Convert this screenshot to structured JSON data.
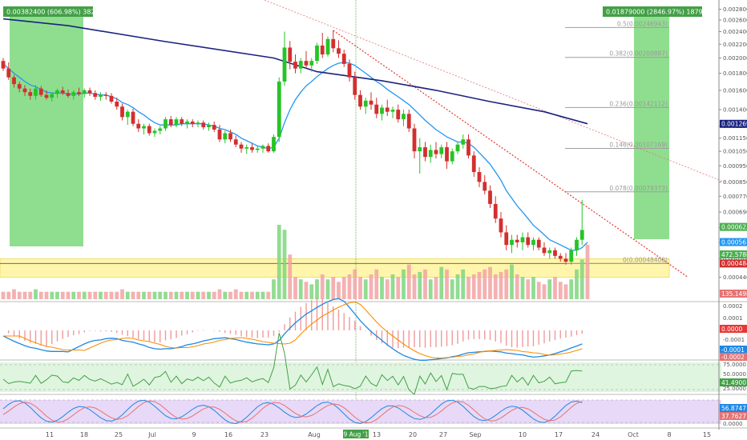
{
  "chart_data": {
    "type": "candlestick",
    "grid": false,
    "price_axis": {
      "ticks": [
        "0.00280000",
        "0.00260000",
        "0.00240000",
        "0.00220000",
        "0.00200000",
        "0.00180000",
        "0.00160000",
        "0.00140000",
        "0.00125000",
        "0.00115000",
        "0.00105000",
        "0.00095000",
        "0.00085000",
        "0.00077000",
        "0.00069000",
        "0.00062000",
        "0.00056000",
        "0.00050000",
        "0.00044000"
      ],
      "tick_values": [
        0.0028,
        0.0026,
        0.0024,
        0.0022,
        0.002,
        0.0018,
        0.0016,
        0.0014,
        0.00125,
        0.00115,
        0.00105,
        0.00095,
        0.00085,
        0.00077,
        0.00069,
        0.00062,
        0.00056,
        0.0005,
        0.00044
      ],
      "scale": "log"
    },
    "time_axis": {
      "labels": [
        "11",
        "18",
        "25",
        "Jul",
        "9",
        "16",
        "23",
        "Aug",
        "13",
        "20",
        "27",
        "Sep",
        "10",
        "17",
        "24",
        "Oct",
        "8",
        "15"
      ],
      "highlight": "09 Aug '18"
    },
    "candles": [
      [
        0.00196,
        0.002,
        0.00183,
        0.00186
      ],
      [
        0.00186,
        0.00194,
        0.00172,
        0.00175
      ],
      [
        0.00175,
        0.00178,
        0.00163,
        0.00167
      ],
      [
        0.00167,
        0.0017,
        0.00158,
        0.00162
      ],
      [
        0.00162,
        0.00166,
        0.00154,
        0.00158
      ],
      [
        0.00158,
        0.00162,
        0.0015,
        0.00154
      ],
      [
        0.00154,
        0.00166,
        0.0015,
        0.00162
      ],
      [
        0.00162,
        0.00165,
        0.00153,
        0.00155
      ],
      [
        0.00155,
        0.0016,
        0.0015,
        0.00152
      ],
      [
        0.00152,
        0.00158,
        0.00148,
        0.00156
      ],
      [
        0.00156,
        0.00162,
        0.00152,
        0.0016
      ],
      [
        0.0016,
        0.00164,
        0.00155,
        0.00157
      ],
      [
        0.00157,
        0.00161,
        0.00152,
        0.00154
      ],
      [
        0.00154,
        0.0016,
        0.0015,
        0.00158
      ],
      [
        0.00158,
        0.00163,
        0.00154,
        0.00156
      ],
      [
        0.00156,
        0.00162,
        0.00152,
        0.0016
      ],
      [
        0.0016,
        0.00163,
        0.00154,
        0.00157
      ],
      [
        0.00157,
        0.0016,
        0.0015,
        0.00153
      ],
      [
        0.00153,
        0.00158,
        0.00149,
        0.00155
      ],
      [
        0.00155,
        0.00158,
        0.0015,
        0.00154
      ],
      [
        0.00154,
        0.00157,
        0.00146,
        0.00148
      ],
      [
        0.00148,
        0.00152,
        0.0014,
        0.00143
      ],
      [
        0.00143,
        0.00146,
        0.0013,
        0.00133
      ],
      [
        0.00133,
        0.0014,
        0.00126,
        0.00138
      ],
      [
        0.00138,
        0.00141,
        0.00125,
        0.00127
      ],
      [
        0.00127,
        0.00131,
        0.0012,
        0.00123
      ],
      [
        0.00123,
        0.00127,
        0.00118,
        0.00125
      ],
      [
        0.00125,
        0.00127,
        0.00117,
        0.00119
      ],
      [
        0.00119,
        0.00123,
        0.00116,
        0.00121
      ],
      [
        0.00121,
        0.00125,
        0.00118,
        0.00123
      ],
      [
        0.00123,
        0.00133,
        0.00121,
        0.00131
      ],
      [
        0.00131,
        0.00134,
        0.00124,
        0.00126
      ],
      [
        0.00126,
        0.00133,
        0.00124,
        0.00131
      ],
      [
        0.00131,
        0.00133,
        0.00125,
        0.00127
      ],
      [
        0.00127,
        0.00131,
        0.00123,
        0.00129
      ],
      [
        0.00129,
        0.00131,
        0.00124,
        0.00127
      ],
      [
        0.00127,
        0.0013,
        0.00124,
        0.00128
      ],
      [
        0.00128,
        0.0013,
        0.00122,
        0.00124
      ],
      [
        0.00124,
        0.00128,
        0.00121,
        0.00126
      ],
      [
        0.00126,
        0.00129,
        0.0012,
        0.00122
      ],
      [
        0.00122,
        0.00126,
        0.00112,
        0.00114
      ],
      [
        0.00114,
        0.00121,
        0.00111,
        0.00119
      ],
      [
        0.00119,
        0.00122,
        0.00112,
        0.00114
      ],
      [
        0.00114,
        0.00117,
        0.00108,
        0.0011
      ],
      [
        0.0011,
        0.00112,
        0.00104,
        0.00107
      ],
      [
        0.00107,
        0.0011,
        0.00103,
        0.00108
      ],
      [
        0.00108,
        0.00111,
        0.00104,
        0.00106
      ],
      [
        0.00106,
        0.00109,
        0.00104,
        0.00107
      ],
      [
        0.00107,
        0.0011,
        0.00104,
        0.00109
      ],
      [
        0.00109,
        0.00111,
        0.00104,
        0.00105
      ],
      [
        0.00105,
        0.00118,
        0.00104,
        0.00116
      ],
      [
        0.00116,
        0.00175,
        0.00112,
        0.0017
      ],
      [
        0.0017,
        0.0024,
        0.00165,
        0.00215
      ],
      [
        0.00215,
        0.00225,
        0.00185,
        0.00195
      ],
      [
        0.00195,
        0.00205,
        0.0018,
        0.00186
      ],
      [
        0.00186,
        0.002,
        0.0018,
        0.00196
      ],
      [
        0.00196,
        0.0021,
        0.00186,
        0.0019
      ],
      [
        0.0019,
        0.002,
        0.00182,
        0.00196
      ],
      [
        0.00196,
        0.00222,
        0.00192,
        0.00218
      ],
      [
        0.00218,
        0.00238,
        0.002,
        0.00205
      ],
      [
        0.00205,
        0.00232,
        0.00202,
        0.00228
      ],
      [
        0.00228,
        0.00242,
        0.00208,
        0.00214
      ],
      [
        0.00214,
        0.00226,
        0.002,
        0.00206
      ],
      [
        0.00206,
        0.00212,
        0.00188,
        0.00192
      ],
      [
        0.00192,
        0.00198,
        0.0017,
        0.00175
      ],
      [
        0.00175,
        0.00182,
        0.0015,
        0.00155
      ],
      [
        0.00155,
        0.0016,
        0.0014,
        0.00143
      ],
      [
        0.00143,
        0.00152,
        0.00136,
        0.00149
      ],
      [
        0.00149,
        0.00158,
        0.0014,
        0.00145
      ],
      [
        0.00145,
        0.00152,
        0.00132,
        0.00136
      ],
      [
        0.00136,
        0.00145,
        0.0013,
        0.00142
      ],
      [
        0.00142,
        0.0015,
        0.00134,
        0.00138
      ],
      [
        0.00138,
        0.00143,
        0.00132,
        0.0014
      ],
      [
        0.0014,
        0.00145,
        0.00128,
        0.00131
      ],
      [
        0.00131,
        0.0014,
        0.00125,
        0.00136
      ],
      [
        0.00136,
        0.0014,
        0.0012,
        0.00123
      ],
      [
        0.00123,
        0.00127,
        0.001,
        0.00105
      ],
      [
        0.00105,
        0.00115,
        0.0009,
        0.00108
      ],
      [
        0.00108,
        0.00112,
        0.00098,
        0.00101
      ],
      [
        0.00101,
        0.0011,
        0.00097,
        0.00106
      ],
      [
        0.00106,
        0.00112,
        0.001,
        0.00103
      ],
      [
        0.00103,
        0.0011,
        0.001,
        0.00108
      ],
      [
        0.00108,
        0.00112,
        0.00093,
        0.00098
      ],
      [
        0.00098,
        0.00107,
        0.00096,
        0.00105
      ],
      [
        0.00105,
        0.00112,
        0.00103,
        0.0011
      ],
      [
        0.0011,
        0.00118,
        0.00107,
        0.00114
      ],
      [
        0.00114,
        0.00118,
        0.001,
        0.00102
      ],
      [
        0.00102,
        0.00105,
        0.00088,
        0.00091
      ],
      [
        0.00091,
        0.00094,
        0.00082,
        0.00085
      ],
      [
        0.00085,
        0.00089,
        0.00078,
        0.0008
      ],
      [
        0.0008,
        0.00083,
        0.00071,
        0.00073
      ],
      [
        0.00073,
        0.00077,
        0.00064,
        0.00066
      ],
      [
        0.00066,
        0.00069,
        0.00058,
        0.0006
      ],
      [
        0.0006,
        0.00063,
        0.00053,
        0.00055
      ],
      [
        0.00055,
        0.00059,
        0.00052,
        0.00057
      ],
      [
        0.00057,
        0.00059,
        0.00054,
        0.00056
      ],
      [
        0.00056,
        0.0006,
        0.00053,
        0.00058
      ],
      [
        0.00058,
        0.0006,
        0.00054,
        0.00055
      ],
      [
        0.00055,
        0.00058,
        0.00053,
        0.00057
      ],
      [
        0.00057,
        0.00058,
        0.00053,
        0.00054
      ],
      [
        0.00054,
        0.00056,
        0.00051,
        0.00052
      ],
      [
        0.00052,
        0.00054,
        0.0005,
        0.00053
      ],
      [
        0.00053,
        0.00054,
        0.0005,
        0.00051
      ],
      [
        0.00051,
        0.00052,
        0.00049,
        0.0005
      ],
      [
        0.0005,
        0.00052,
        0.00048,
        0.00049
      ],
      [
        0.00049,
        0.00054,
        0.00048,
        0.00053
      ],
      [
        0.00053,
        0.00058,
        0.00051,
        0.00057
      ],
      [
        0.00057,
        0.00075,
        0.00055,
        0.00061
      ]
    ],
    "ma_fast": [
      0.00192,
      0.00186,
      0.0018,
      0.00175,
      0.0017,
      0.00166,
      0.00164,
      0.00161,
      0.00158,
      0.00157,
      0.00157,
      0.00157,
      0.00156,
      0.00156,
      0.00156,
      0.00157,
      0.00157,
      0.00156,
      0.00155,
      0.00155,
      0.00153,
      0.00151,
      0.00147,
      0.00145,
      0.00142,
      0.00138,
      0.00135,
      0.00131,
      0.00128,
      0.00126,
      0.00126,
      0.00126,
      0.00126,
      0.00127,
      0.00127,
      0.00127,
      0.00127,
      0.00127,
      0.00126,
      0.00125,
      0.00123,
      0.00122,
      0.0012,
      0.00118,
      0.00115,
      0.00113,
      0.00111,
      0.00109,
      0.00108,
      0.00107,
      0.00108,
      0.00115,
      0.00128,
      0.0014,
      0.0015,
      0.00158,
      0.00165,
      0.0017,
      0.00176,
      0.00181,
      0.00186,
      0.0019,
      0.00193,
      0.00194,
      0.00193,
      0.0019,
      0.00185,
      0.0018,
      0.00175,
      0.0017,
      0.00166,
      0.00161,
      0.00157,
      0.00153,
      0.00149,
      0.00145,
      0.0014,
      0.00135,
      0.0013,
      0.00126,
      0.00122,
      0.00119,
      0.00116,
      0.00114,
      0.00112,
      0.00112,
      0.00111,
      0.00108,
      0.00104,
      0.001,
      0.00096,
      0.00091,
      0.00086,
      0.0008,
      0.00076,
      0.00072,
      0.00069,
      0.00066,
      0.00063,
      0.00061,
      0.00059,
      0.00057,
      0.00056,
      0.00055,
      0.00054,
      0.00053,
      0.00053,
      0.00054,
      0.00056
    ],
    "ma_slow": [
      0.00262,
      0.0025,
      0.00224,
      0.002,
      0.00182,
      0.00171,
      0.0016,
      0.00148,
      0.00138,
      0.00127
    ],
    "ma_slow_at_candle": [
      0,
      12,
      30,
      50,
      58,
      70,
      80,
      90,
      100,
      108
    ],
    "trendline_1": [
      [
        52,
        0.00262
      ],
      [
        125,
        0.00132
      ]
    ],
    "trendline_2": [
      [
        61,
        0.00242
      ],
      [
        114,
        0.00044
      ]
    ],
    "fib_levels": [
      {
        "label": "0.5(0.00246943)",
        "value": 0.00246943
      },
      {
        "label": "0.382(0.00200887)",
        "value": 0.00200887
      },
      {
        "label": "0.236(0.00142112)",
        "value": 0.00142112
      },
      {
        "label": "0.146(0.00107169)",
        "value": 0.00107169
      },
      {
        "label": "0.078(0.00079373)",
        "value": 0.00079373
      },
      {
        "label": "0(0.00048400)",
        "value": 0.000484
      }
    ],
    "price_tags": [
      {
        "text": "0.00062300",
        "value": 0.000623,
        "color": "#4caf50"
      },
      {
        "text": "0.00056110",
        "value": 0.0005611,
        "color": "#2196f3"
      },
      {
        "text": "0.00048400",
        "value": 0.000484,
        "color": "#d32f2f"
      },
      {
        "text": "0.00126959",
        "value": 0.00126959,
        "color": "#1a237e"
      }
    ],
    "volume_tags": [
      {
        "text": "472.578K",
        "color": "#4caf50"
      },
      {
        "text": "135.149K",
        "color": "#e57373"
      }
    ],
    "measure_boxes": [
      {
        "label": "0.00382400 (606.98%) 382400",
        "color": "#4caf50"
      },
      {
        "label": "0.01879000 (2846.97%) 1879000",
        "color": "#4caf50"
      }
    ],
    "support_zone": [
      0.00044,
      0.0005
    ],
    "volumes": [
      3,
      3,
      4,
      3,
      3,
      3,
      4,
      3,
      3,
      3,
      3,
      3,
      3,
      3,
      3,
      3,
      3,
      3,
      3,
      3,
      3,
      3,
      4,
      3,
      3,
      3,
      3,
      3,
      3,
      3,
      3,
      3,
      3,
      3,
      3,
      3,
      3,
      3,
      3,
      3,
      4,
      3,
      3,
      4,
      3,
      3,
      3,
      3,
      3,
      3,
      8,
      30,
      28,
      18,
      9,
      8,
      7,
      6,
      8,
      10,
      8,
      9,
      7,
      9,
      10,
      12,
      9,
      8,
      10,
      12,
      9,
      8,
      10,
      9,
      12,
      14,
      10,
      11,
      12,
      8,
      9,
      13,
      12,
      8,
      10,
      12,
      9,
      10,
      11,
      12,
      13,
      10,
      11,
      12,
      14,
      10,
      9,
      8,
      9,
      7,
      6,
      8,
      9,
      7,
      6,
      8,
      12,
      16,
      22
    ],
    "macd_ticks": [
      "0.0002",
      "0.0001",
      "0.0000",
      "-0.0001",
      "-0.0002"
    ],
    "macd_tags": [
      {
        "text": "0.0000",
        "color": "#e53935"
      },
      {
        "text": "-0.0001",
        "color": "#1e88e5"
      },
      {
        "text": "-0.0002",
        "color": "#e57373"
      }
    ],
    "rsi_ticks": [
      "75.0000",
      "50.0000",
      "25.0000"
    ],
    "rsi_tags": [
      {
        "text": "41.4900",
        "color": "#43a047"
      }
    ],
    "stoch_ticks": [
      "0.0000"
    ],
    "stoch_tags": [
      {
        "text": "56.8747",
        "color": "#1e88e5"
      },
      {
        "text": "37.7627",
        "color": "#e57373"
      }
    ]
  }
}
